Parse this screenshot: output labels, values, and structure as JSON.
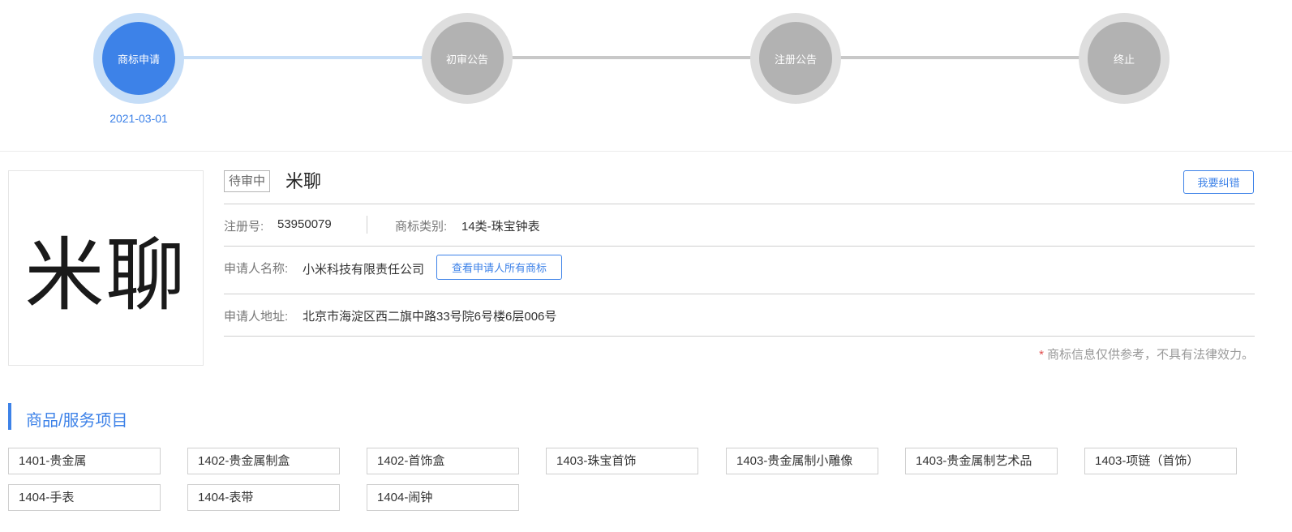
{
  "stepper": {
    "steps": [
      {
        "label": "商标申请",
        "date": "2021-03-01",
        "state": "active"
      },
      {
        "label": "初审公告",
        "date": "",
        "state": "inactive"
      },
      {
        "label": "注册公告",
        "date": "",
        "state": "inactive"
      },
      {
        "label": "终止",
        "date": "",
        "state": "inactive"
      }
    ]
  },
  "trademark": {
    "image_text": "米聊",
    "status": "待审中",
    "name": "米聊",
    "report_button": "我要纠错",
    "reg_no_label": "注册号:",
    "reg_no": "53950079",
    "category_label": "商标类别:",
    "category": "14类-珠宝钟表",
    "applicant_label": "申请人名称:",
    "applicant": "小米科技有限责任公司",
    "view_all_button": "查看申请人所有商标",
    "address_label": "申请人地址:",
    "address": "北京市海淀区西二旗中路33号院6号楼6层006号",
    "disclaimer_star": "*",
    "disclaimer": "商标信息仅供参考，不具有法律效力。"
  },
  "goods": {
    "title": "商品/服务项目",
    "items": [
      "1401-贵金属",
      "1402-贵金属制盒",
      "1402-首饰盒",
      "1403-珠宝首饰",
      "1403-贵金属制小雕像",
      "1403-贵金属制艺术品",
      "1403-项链（首饰）",
      "1404-手表",
      "1404-表带",
      "1404-闹钟"
    ]
  },
  "colors": {
    "accent": "#3d82e8",
    "step_active_ring": "#c5ddf7",
    "step_inactive": "#b2b2b2",
    "disclaimer_star": "#e04a4a"
  }
}
